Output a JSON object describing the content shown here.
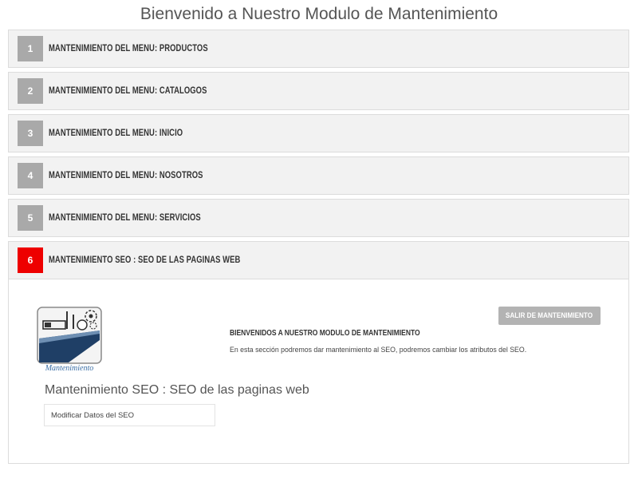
{
  "page": {
    "title": "Bienvenido a Nuestro Modulo de Mantenimiento"
  },
  "menu_items": [
    {
      "number": "1",
      "label": "MANTENIMIENTO DEL MENU: PRODUCTOS",
      "active": false
    },
    {
      "number": "2",
      "label": "MANTENIMIENTO DEL MENU: CATALOGOS",
      "active": false
    },
    {
      "number": "3",
      "label": "MANTENIMIENTO DEL MENU: INICIO",
      "active": false
    },
    {
      "number": "4",
      "label": "MANTENIMIENTO DEL MENU: NOSOTROS",
      "active": false
    },
    {
      "number": "5",
      "label": "MANTENIMIENTO DEL MENU: SERVICIOS",
      "active": false
    },
    {
      "number": "6",
      "label": "MANTENIMIENTO SEO : SEO DE LAS PAGINAS WEB",
      "active": true
    }
  ],
  "panel": {
    "logo_text": "Mantenimiento",
    "exit_button": "SALIR DE MANTENIMIENTO",
    "welcome_heading": "BIENVENIDOS A NUESTRO MODULO DE MANTENIMIENTO",
    "description": "En esta sección podremos dar mantenimiento al SEO, podremos cambiar los atributos del SEO.",
    "section_title": "Mantenimiento SEO : SEO de las paginas web",
    "action_button": "Modificar Datos del SEO"
  },
  "colors": {
    "number_badge": "#a9a9a9",
    "active_badge": "#ee0000",
    "header_bg": "#f2f2f2",
    "button_gray": "#b3b3b3"
  }
}
